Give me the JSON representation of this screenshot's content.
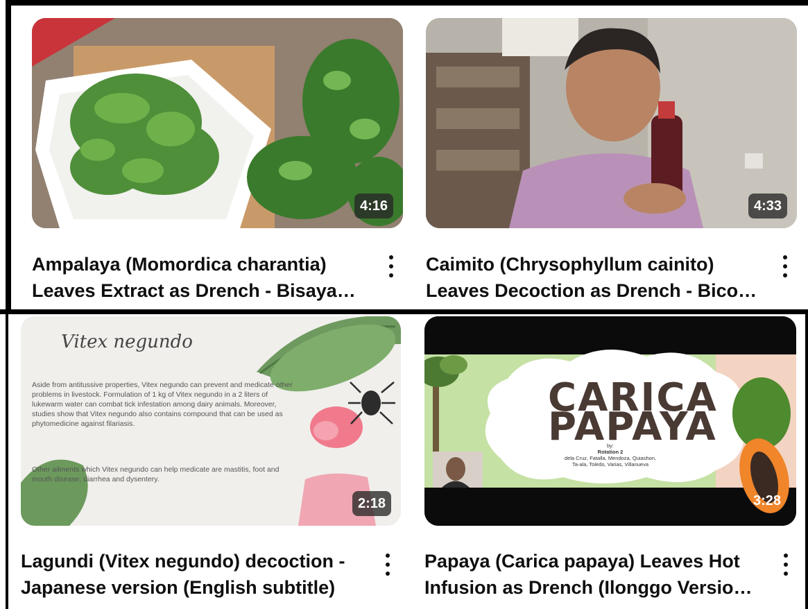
{
  "videos": [
    {
      "title_line1": "Ampalaya (Momordica charantia)",
      "title_line2": "Leaves Extract as Drench - Bisaya…",
      "duration": "4:16"
    },
    {
      "title_line1": "Caimito (Chrysophyllum cainito)",
      "title_line2": "Leaves Decoction as Drench - Bico…",
      "duration": "4:33"
    },
    {
      "title_line1": "Lagundi (Vitex negundo) decoction -",
      "title_line2": "Japanese version (English subtitle)",
      "duration": "2:18",
      "slide": {
        "heading": "Vitex negundo",
        "para1": "Aside from antitussive properties, Vitex negundo can prevent and medicate other problems in livestock. Formulation of 1 kg of Vitex negundo in a 2 liters of lukewarm water can combat tick infestation among dairy animals. Moreover, studies show that Vitex negundo also contains compound that can be used as phytomedicine against filariasis.",
        "para2": "Other ailments which Vitex negundo can help medicate are mastitis, foot and mouth disease, diarrhea and dysentery."
      }
    },
    {
      "title_line1": "Papaya (Carica papaya) Leaves Hot",
      "title_line2": "Infusion as Drench (Ilonggo Versio…",
      "duration": "3:28",
      "slide": {
        "heading_line1": "CARICA",
        "heading_line2": "PAPAYA",
        "by": "by:",
        "group": "Rotation 2",
        "members_line1": "dela Cruz, Fatalla, Mendoza, Quiashon,",
        "members_line2": "Ta-ala, Toledo, Varias, Villanueva"
      }
    }
  ],
  "icons": {
    "more": "more-vert-icon"
  },
  "colors": {
    "title_text": "#0f0f0f",
    "duration_bg": "#282828",
    "frame": "#000000"
  }
}
